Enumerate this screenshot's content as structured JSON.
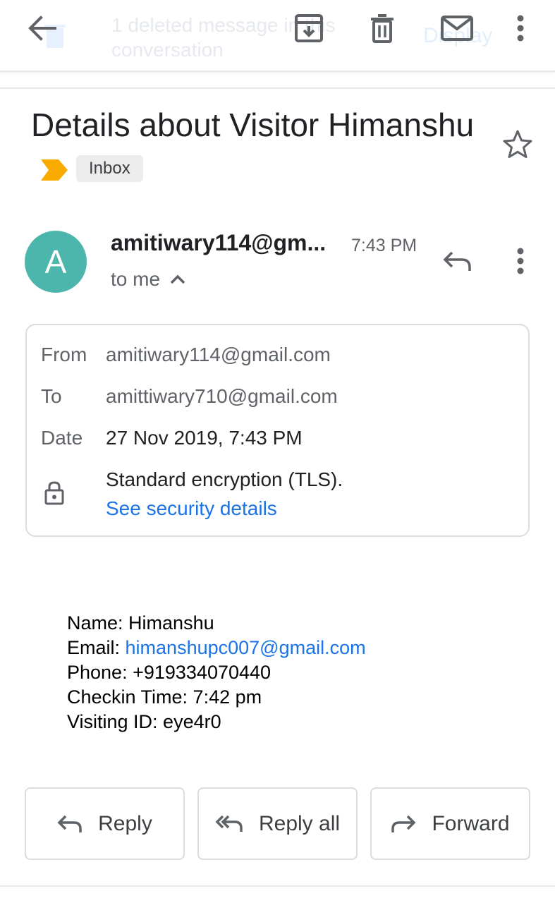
{
  "snackbar": {
    "message": "1 deleted message in this conversation",
    "action": "Display"
  },
  "toolbar": {
    "icons": [
      "arrow-back",
      "archive",
      "delete",
      "mail-unread",
      "more-vert"
    ]
  },
  "subject": {
    "title": "Details about Visitor Himanshu",
    "label": "Inbox",
    "importance_color": "#f9ab00"
  },
  "message": {
    "avatar_letter": "A",
    "avatar_color": "#4db6ac",
    "sender": "amitiwary114@gm...",
    "time": "7:43 PM",
    "recipient_summary": "to me"
  },
  "details": {
    "from_label": "From",
    "from_value": "amitiwary114@gmail.com",
    "to_label": "To",
    "to_value": "amittiwary710@gmail.com",
    "date_label": "Date",
    "date_value": "27 Nov 2019, 7:43 PM",
    "encryption": "Standard encryption (TLS).",
    "security_link": "See security details"
  },
  "body": {
    "name_label": "Name:",
    "name_value": "Himanshu",
    "email_label": "Email:",
    "email_value": "himanshupc007@gmail.com",
    "phone": "Phone: +919334070440",
    "checkin": "Checkin Time: 7:42 pm",
    "visiting_id": "Visiting ID: eye4r0"
  },
  "actions": {
    "reply": "Reply",
    "reply_all": "Reply all",
    "forward": "Forward"
  }
}
